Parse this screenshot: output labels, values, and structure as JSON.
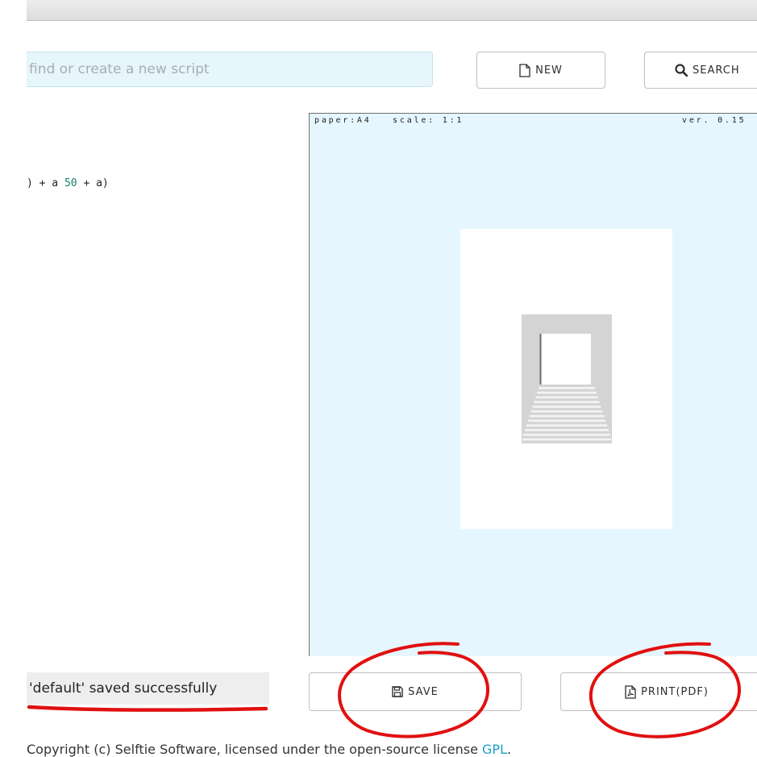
{
  "search": {
    "placeholder": "find or create a new script",
    "value": ""
  },
  "toolbar": {
    "new_label": "NEW",
    "new_icon": "file-icon",
    "search_label": "SEARCH",
    "search_icon": "magnifier-icon"
  },
  "editor": {
    "code_prefix": ") + a ",
    "code_number": "50",
    "code_suffix": " + a)"
  },
  "preview": {
    "paper_label": "paper:A4",
    "scale_label": "scale: 1:1",
    "version_label": "ver. 0.15"
  },
  "status": {
    "message": "'default' saved successfully"
  },
  "actions": {
    "save_label": "SAVE",
    "save_icon": "floppy-disk-icon",
    "print_label": "PRINT(PDF)",
    "print_icon": "pdf-file-icon"
  },
  "footer": {
    "text": "Copyright (c) Selftie Software, licensed under the open-source license ",
    "link_label": "GPL",
    "trailing": "."
  },
  "colors": {
    "annotation": "#e11010",
    "preview_background": "#e6f6fe",
    "link": "#17a3c6"
  }
}
